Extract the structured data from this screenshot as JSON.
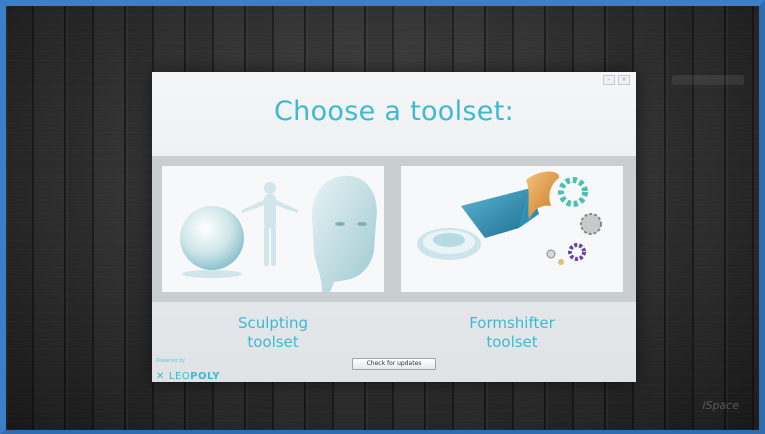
{
  "dialog": {
    "title": "Choose a toolset:",
    "window_buttons": [
      "–",
      "×"
    ]
  },
  "toolsets": [
    {
      "line1": "Sculpting",
      "line2": "toolset"
    },
    {
      "line1": "Formshifter",
      "line2": "toolset"
    }
  ],
  "update_button": {
    "label": "Check for updates"
  },
  "logo": {
    "powered": "Powered by",
    "brand_a": "LEO",
    "brand_b": "POLY"
  },
  "watermark": "iSpace",
  "colors": {
    "accent": "#3dbad0",
    "frame": "#3a7fc8"
  }
}
